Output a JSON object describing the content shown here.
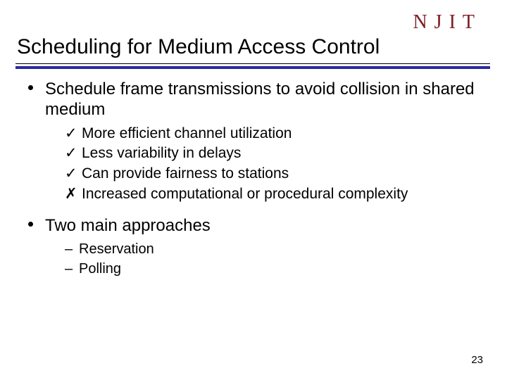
{
  "logo": "NJIT",
  "title": "Scheduling for Medium Access Control",
  "bullets": [
    {
      "text": "Schedule frame transmissions to avoid collision in shared medium",
      "sub": [
        {
          "mark": "✓",
          "text": "More efficient channel utilization"
        },
        {
          "mark": "✓",
          "text": "Less variability in delays"
        },
        {
          "mark": "✓",
          "text": "Can provide fairness to stations"
        },
        {
          "mark": "✗",
          "text": "Increased computational or procedural complexity"
        }
      ]
    },
    {
      "text": "Two main approaches",
      "sub2": [
        {
          "text": "Reservation"
        },
        {
          "text": "Polling"
        }
      ]
    }
  ],
  "page_number": "23"
}
